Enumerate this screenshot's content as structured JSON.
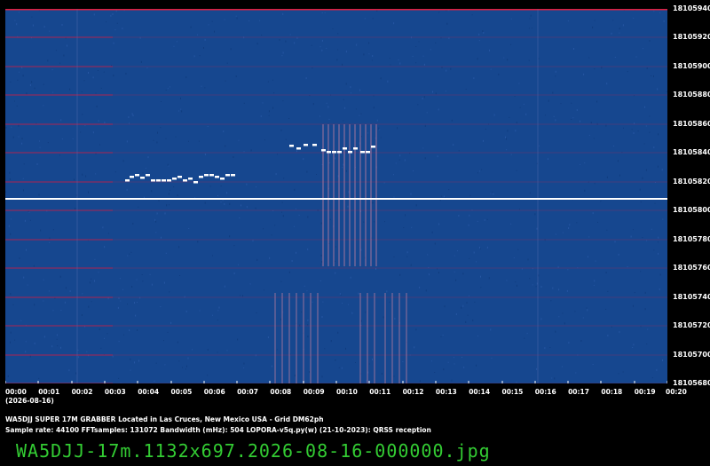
{
  "y_axis_labels": [
    "18105940",
    "18105920",
    "18105900",
    "18105880",
    "18105860",
    "18105840",
    "18105820",
    "18105800",
    "18105780",
    "18105760",
    "18105740",
    "18105720",
    "18105700",
    "18105680"
  ],
  "x_axis_labels": [
    "00:00",
    "00:01",
    "00:02",
    "00:03",
    "00:04",
    "00:05",
    "00:06",
    "00:07",
    "00:08",
    "00:09",
    "00:10",
    "00:11",
    "00:12",
    "00:13",
    "00:14",
    "00:15",
    "00:16",
    "00:17",
    "00:18",
    "00:19",
    "00:20"
  ],
  "date_label": "(2026-08-16)",
  "info_line1": "WA5DJJ SUPER 17M GRABBER Located in Las Cruces, New Mexico USA - Grid DM62ph",
  "info_line2": "Sample rate: 44100    FFTsamples: 131072    Bandwidth (mHz): 504         LOPORA-v5q.py(w) (21-10-2023): QRSS reception",
  "filename": "WA5DJJ-17m.1132x697.2026-08-16-000000.jpg",
  "colors": {
    "background": "#000000",
    "waterfall": "#16478f",
    "gridline": "#c0204a",
    "carrier": "#ffffff",
    "signal": "#ffffff",
    "filename": "#33cc33"
  }
}
